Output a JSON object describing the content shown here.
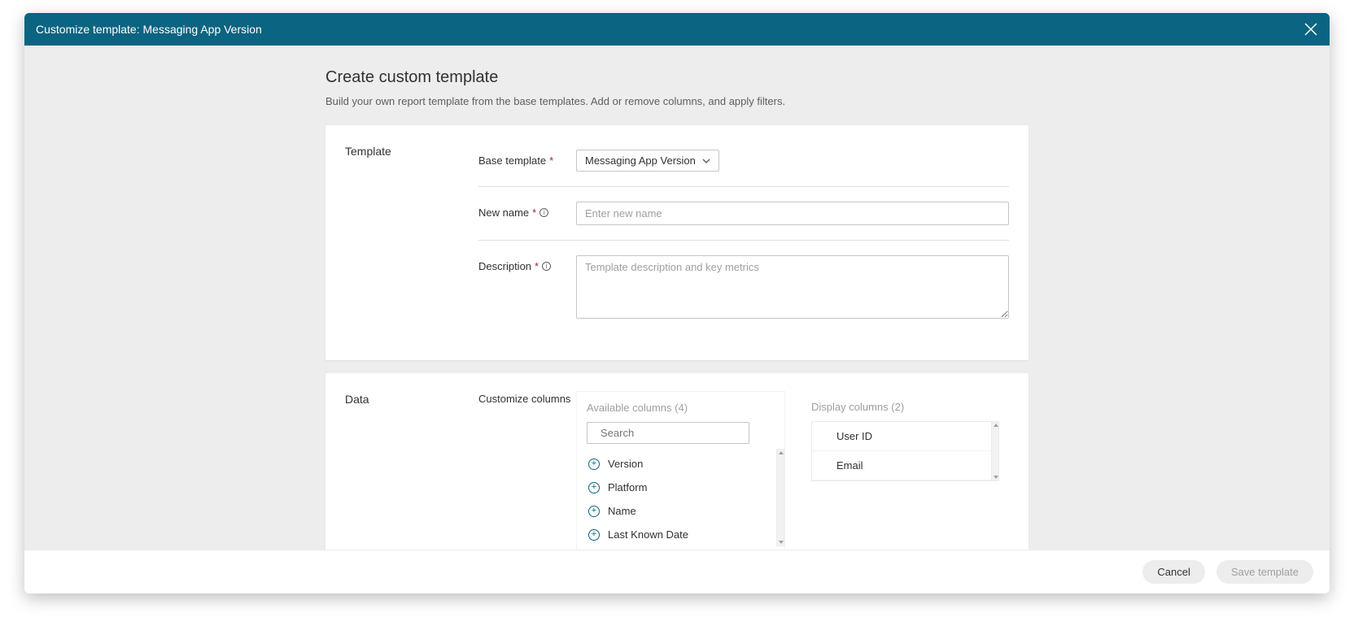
{
  "accent": "#0b6481",
  "header": {
    "title": "Customize template: Messaging App Version"
  },
  "page": {
    "heading": "Create custom template",
    "subtitle": "Build your own report template from the base templates. Add or remove columns, and apply filters."
  },
  "template_section": {
    "label": "Template",
    "base_template": {
      "label": "Base template",
      "value": "Messaging App Version"
    },
    "new_name": {
      "label": "New name",
      "placeholder": "Enter new name",
      "value": ""
    },
    "description": {
      "label": "Description",
      "placeholder": "Template description and key metrics",
      "value": ""
    }
  },
  "data_section": {
    "label": "Data",
    "customize_label": "Customize columns",
    "available": {
      "label_prefix": "Available columns",
      "count": 4,
      "search_placeholder": "Search",
      "items": [
        "Version",
        "Platform",
        "Name",
        "Last Known Date"
      ]
    },
    "display": {
      "label_prefix": "Display columns",
      "count": 2,
      "items": [
        "User ID",
        "Email"
      ]
    }
  },
  "footer": {
    "cancel": "Cancel",
    "save": "Save template"
  }
}
